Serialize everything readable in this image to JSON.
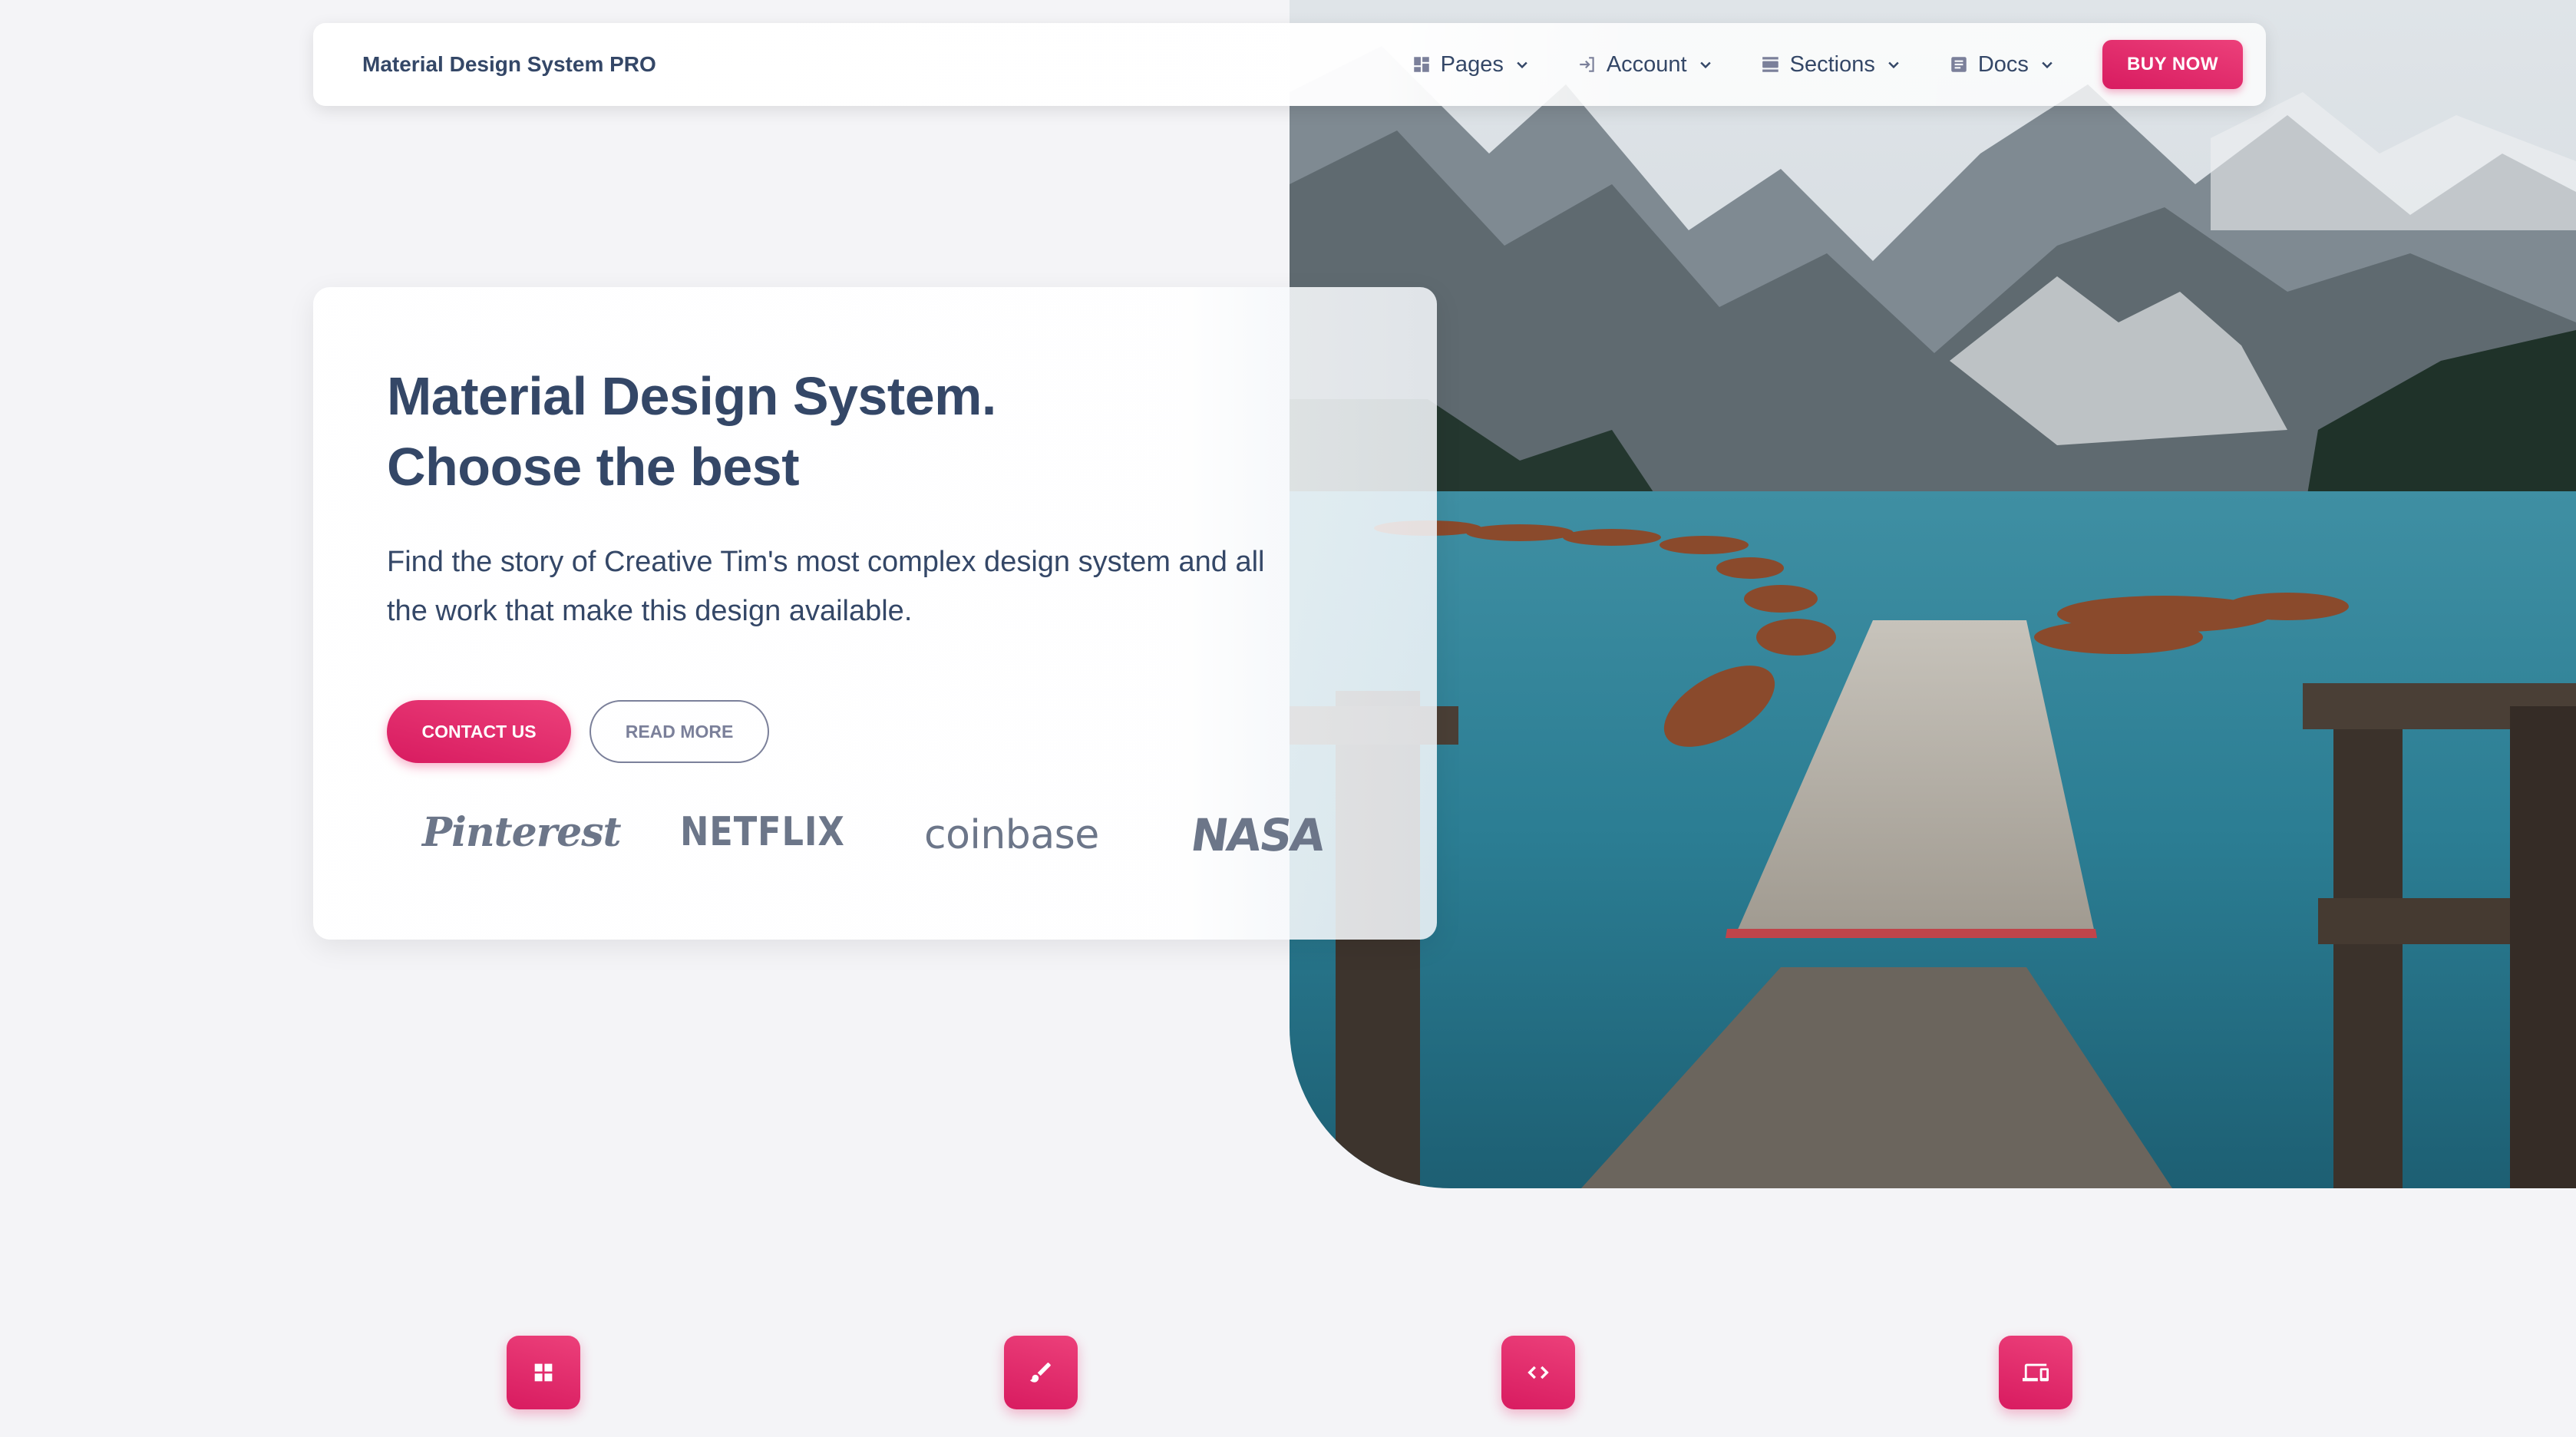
{
  "navbar": {
    "brand": "Material Design System PRO",
    "items": [
      {
        "label": "Pages",
        "icon": "dashboard-icon"
      },
      {
        "label": "Account",
        "icon": "login-icon"
      },
      {
        "label": "Sections",
        "icon": "view-day-icon"
      },
      {
        "label": "Docs",
        "icon": "article-icon"
      }
    ],
    "buy_label": "BUY NOW"
  },
  "hero": {
    "title_line1": "Material Design System.",
    "title_line2": "Choose the best",
    "text": "Find the story of Creative Tim's most complex design system and all the work that make this design available.",
    "contact_label": "CONTACT US",
    "read_more_label": "READ MORE",
    "logos": [
      "Pinterest",
      "NETFLIX",
      "coinbase",
      "NASA"
    ]
  },
  "features": {
    "icons": [
      "grid-icon",
      "brush-icon",
      "code-icon",
      "devices-icon"
    ]
  },
  "colors": {
    "primary": "#e91e63",
    "text": "#344767",
    "muted": "#7b809a"
  }
}
